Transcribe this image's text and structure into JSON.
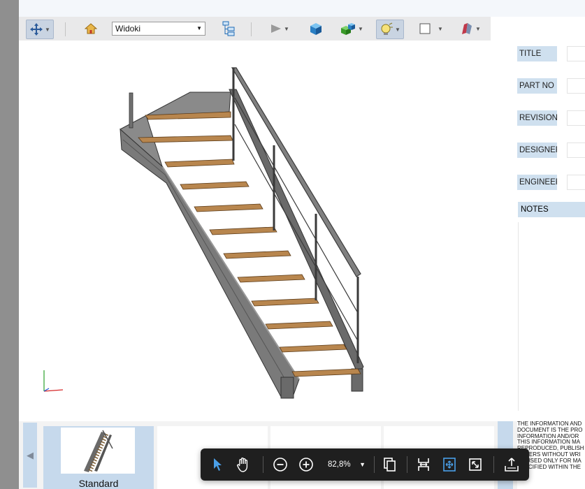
{
  "toolbar": {
    "view_select_value": "Widoki",
    "icons": [
      "move-tool-icon",
      "home-icon",
      "tree-icon",
      "play-icon",
      "cube-icon",
      "colored-cube-icon",
      "light-icon",
      "square-icon",
      "magnet-icon"
    ]
  },
  "title_block": {
    "fields": [
      "TITLE",
      "PART NO",
      "REVISION",
      "DESIGNER",
      "ENGINEER"
    ],
    "notes_label": "NOTES"
  },
  "thumbnails": {
    "active_label": "Standard"
  },
  "disclaimer_lines": [
    "THE INFORMATION AND",
    "DOCUMENT IS THE PRO",
    "INFORMATION AND/OR",
    "THIS INFORMATION MA",
    "REPRODUCED, PUBLISH",
    "OTHERS WITHOUT WRI",
    "BE USED ONLY FOR MA",
    "SPECIFIED WITHIN THE"
  ],
  "zoom_bar": {
    "zoom_level": "82,8%"
  },
  "colors": {
    "accent": "#c6d9ec",
    "toolbar_bg": "#e9e9ea",
    "float_bar_bg": "#1f1f1f",
    "stringer": "#6e6e6e",
    "tread": "#b8864e"
  }
}
